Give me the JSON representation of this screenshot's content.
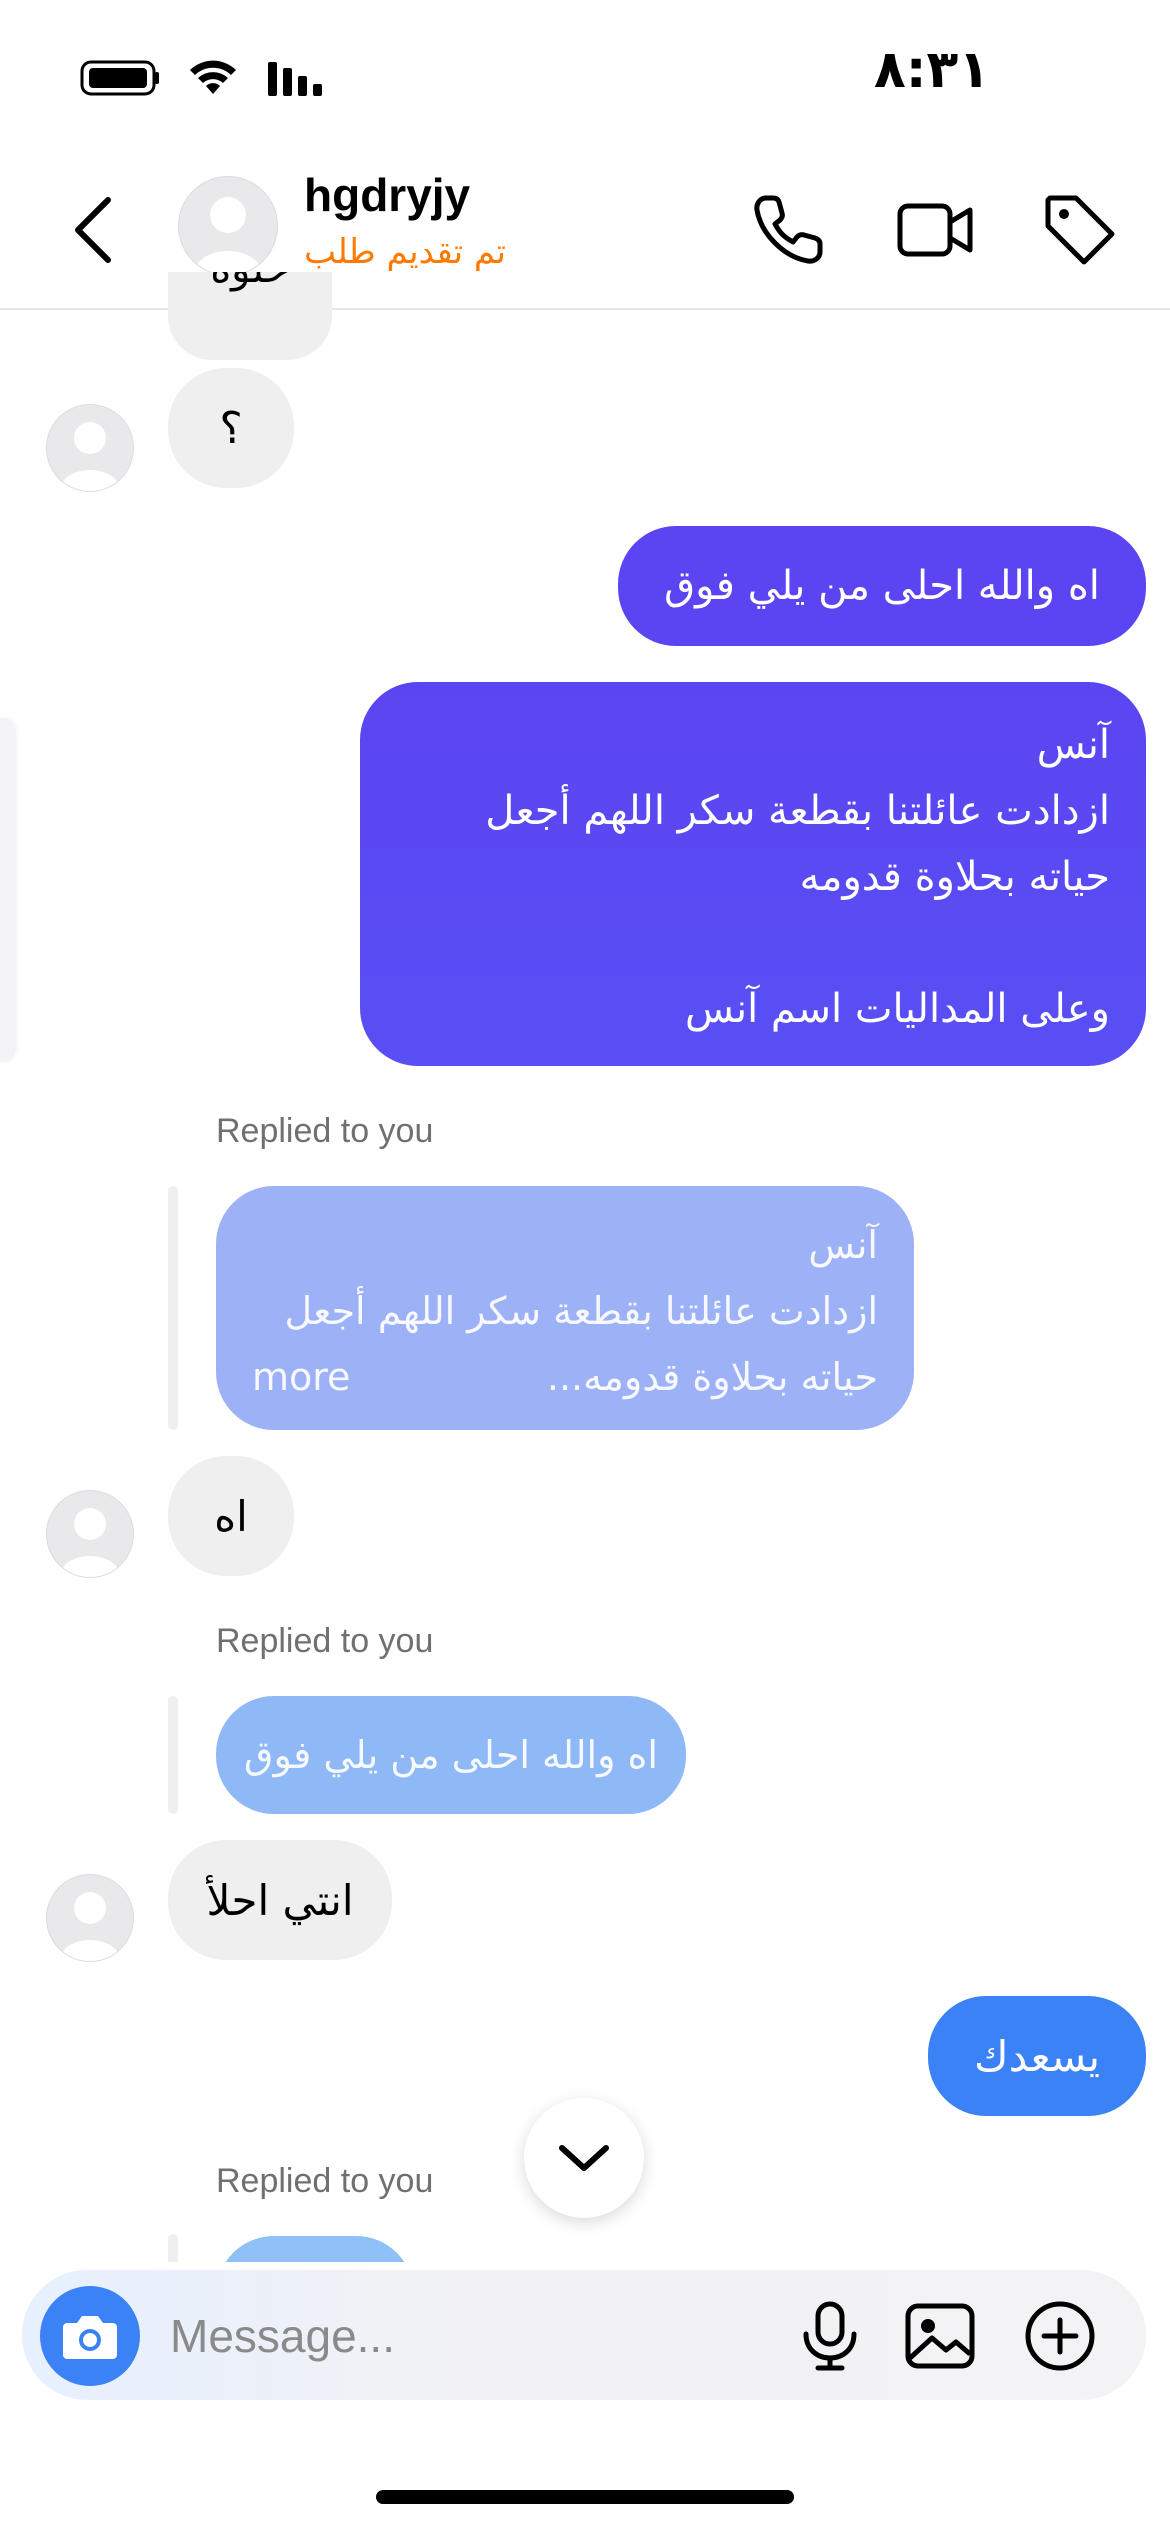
{
  "status_bar": {
    "time": "٨:٣١",
    "battery_icon": "battery-icon",
    "wifi_icon": "wifi-icon",
    "signal_icon": "signal-icon"
  },
  "header": {
    "name": "hgdryjy",
    "subtitle": "تم تقديم طلب",
    "back_icon": "chevron-left-icon",
    "call_icon": "phone-icon",
    "video_icon": "video-icon",
    "tag_icon": "tag-icon"
  },
  "messages": {
    "in_partial": "حلوة",
    "in_question": "؟",
    "out_1": "اه والله احلى من يلي فوق",
    "out_2": {
      "line1": "آنس",
      "line2": "ازدادت عائلتنا بقطعة سكر اللهم أجعل",
      "line3": "حياته بحلاوة قدومه",
      "line4": "وعلى المداليات اسم آنس"
    },
    "reply_label_1": "Replied to you",
    "quoted_1": {
      "line1": "آنس",
      "line2": "ازدادت عائلتنا بقطعة سكر اللهم أجعل",
      "line3": "حياته بحلاوة قدومه...",
      "more": "more"
    },
    "in_ah": "اه",
    "reply_label_2": "Replied to you",
    "quoted_2": "اه والله احلى من يلي فوق",
    "in_anti": "انتي احلأ",
    "out_3": "يسعدك",
    "reply_label_3": "Replied to you"
  },
  "composer": {
    "placeholder": "Message...",
    "camera_icon": "camera-icon",
    "mic_icon": "microphone-icon",
    "gallery_icon": "image-icon",
    "plus_icon": "plus-circle-icon"
  },
  "colors": {
    "outgoing_bubble": "#5b45f2",
    "outgoing_blue": "#3b82f6",
    "quoted_bubble": "#9db1f7",
    "incoming_bubble": "#efefef",
    "subtitle_orange": "#ff7a00"
  }
}
